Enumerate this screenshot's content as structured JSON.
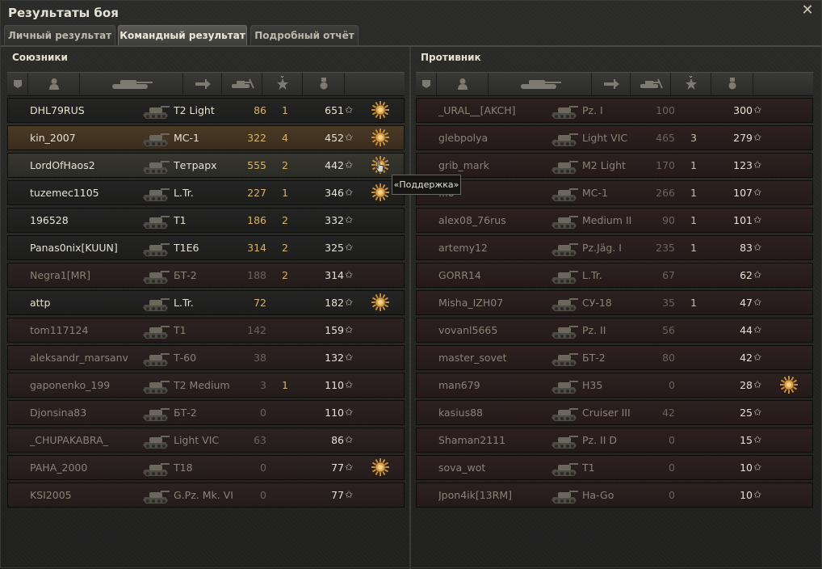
{
  "window": {
    "title": "Результаты боя"
  },
  "tabs": [
    {
      "label": "Личный результат"
    },
    {
      "label": "Командный результат"
    },
    {
      "label": "Подробный отчёт"
    }
  ],
  "active_tab_index": 1,
  "allies": {
    "title": "Союзники",
    "rows": [
      {
        "name": "DHL79RUS",
        "tank": "T2 Light",
        "damage": "86",
        "kills": "1",
        "xp": "651",
        "medal": true,
        "style": "normal"
      },
      {
        "name": "kin_2007",
        "tank": "МС-1",
        "damage": "322",
        "kills": "4",
        "xp": "452",
        "medal": true,
        "style": "highlight"
      },
      {
        "name": "LordOfHaos2",
        "tank": "Тетрарх",
        "damage": "555",
        "kills": "2",
        "xp": "442",
        "medal": true,
        "style": "hover"
      },
      {
        "name": "tuzemec1105",
        "tank": "L.Tr.",
        "damage": "227",
        "kills": "1",
        "xp": "346",
        "medal": true,
        "style": "normal"
      },
      {
        "name": "196528",
        "tank": "T1",
        "damage": "186",
        "kills": "2",
        "xp": "332",
        "medal": false,
        "style": "normal"
      },
      {
        "name": "Panas0nix[KUUN]",
        "tank": "T1E6",
        "damage": "314",
        "kills": "2",
        "xp": "325",
        "medal": false,
        "style": "normal"
      },
      {
        "name": "Negra1[MR]",
        "tank": "БТ-2",
        "damage": "188",
        "kills": "2",
        "xp": "314",
        "medal": false,
        "style": "dim"
      },
      {
        "name": "attp",
        "tank": "L.Tr.",
        "damage": "72",
        "kills": "",
        "xp": "182",
        "medal": true,
        "style": "normal"
      },
      {
        "name": "tom117124",
        "tank": "T1",
        "damage": "142",
        "kills": "",
        "xp": "159",
        "medal": false,
        "style": "dim"
      },
      {
        "name": "aleksandr_marsanv",
        "tank": "Т-60",
        "damage": "38",
        "kills": "",
        "xp": "132",
        "medal": false,
        "style": "dim"
      },
      {
        "name": "gaponenko_199",
        "tank": "T2 Medium",
        "damage": "3",
        "kills": "1",
        "xp": "110",
        "medal": false,
        "style": "dim"
      },
      {
        "name": "Djonsina83",
        "tank": "БТ-2",
        "damage": "0",
        "kills": "",
        "xp": "110",
        "medal": false,
        "style": "dim"
      },
      {
        "name": "_CHUPAKABRA_",
        "tank": "Light VIC",
        "damage": "63",
        "kills": "",
        "xp": "86",
        "medal": false,
        "style": "dim"
      },
      {
        "name": "PAHA_2000",
        "tank": "T18",
        "damage": "0",
        "kills": "",
        "xp": "77",
        "medal": true,
        "style": "dim"
      },
      {
        "name": "KSI2005",
        "tank": "G.Pz. Mk. VI",
        "damage": "0",
        "kills": "",
        "xp": "77",
        "medal": false,
        "style": "dim"
      }
    ]
  },
  "enemies": {
    "title": "Противник",
    "rows": [
      {
        "name": "_URAL__[AKCH]",
        "tank": "Pz. I",
        "damage": "100",
        "kills": "",
        "xp": "300",
        "medal": false
      },
      {
        "name": "glebpolya",
        "tank": "Light VIC",
        "damage": "465",
        "kills": "3",
        "xp": "279",
        "medal": false
      },
      {
        "name": "grib_mark",
        "tank": "M2 Light",
        "damage": "170",
        "kills": "1",
        "xp": "123",
        "medal": false
      },
      {
        "name": "...o",
        "tank": "МС-1",
        "damage": "266",
        "kills": "1",
        "xp": "107",
        "medal": false
      },
      {
        "name": "alex08_76rus",
        "tank": "Medium II",
        "damage": "90",
        "kills": "1",
        "xp": "101",
        "medal": false
      },
      {
        "name": "artemy12",
        "tank": "Pz.Jäg. I",
        "damage": "235",
        "kills": "1",
        "xp": "83",
        "medal": false
      },
      {
        "name": "GORR14",
        "tank": "L.Tr.",
        "damage": "67",
        "kills": "",
        "xp": "62",
        "medal": false
      },
      {
        "name": "Misha_IZH07",
        "tank": "СУ-18",
        "damage": "35",
        "kills": "1",
        "xp": "47",
        "medal": false
      },
      {
        "name": "vovanl5665",
        "tank": "Pz. II",
        "damage": "56",
        "kills": "",
        "xp": "44",
        "medal": false
      },
      {
        "name": "master_sovet",
        "tank": "БТ-2",
        "damage": "80",
        "kills": "",
        "xp": "42",
        "medal": false
      },
      {
        "name": "man679",
        "tank": "H35",
        "damage": "0",
        "kills": "",
        "xp": "28",
        "medal": true
      },
      {
        "name": "kasius88",
        "tank": "Cruiser III",
        "damage": "42",
        "kills": "",
        "xp": "25",
        "medal": false
      },
      {
        "name": "Shaman2111",
        "tank": "Pz. II D",
        "damage": "0",
        "kills": "",
        "xp": "15",
        "medal": false
      },
      {
        "name": "sova_wot",
        "tank": "T1",
        "damage": "0",
        "kills": "",
        "xp": "10",
        "medal": false
      },
      {
        "name": "Jpon4ik[13RM]",
        "tank": "Ha-Go",
        "damage": "0",
        "kills": "",
        "xp": "10",
        "medal": false
      }
    ]
  },
  "tooltip": {
    "text": "«Поддержка»"
  },
  "icons": {
    "close": "close-icon",
    "columns": [
      "platoon-icon",
      "player-icon",
      "tank-icon",
      "damage-icon",
      "kills-icon",
      "xp-star-icon",
      "medal-icon"
    ],
    "xp_star": "star-icon"
  },
  "colors": {
    "damage": "#d8b26a",
    "text": "#e6e2d3",
    "dim_text": "#8c8276",
    "highlight_row": "#4a3a26"
  }
}
